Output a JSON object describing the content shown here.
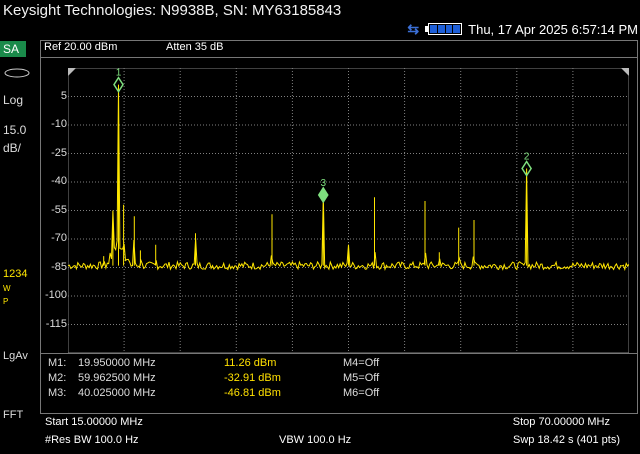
{
  "title": "Keysight Technologies: N9938B, SN: MY63185843",
  "status": {
    "datetime": "Thu, 17 Apr 2025 6:57:14 PM",
    "usb_icon": "usb-icon",
    "battery_icon": "battery-icon",
    "battery_cells": 4
  },
  "left": {
    "mode": "SA",
    "scale_type": "Log",
    "scale_value": "15.0",
    "scale_unit": "dB/",
    "trace_numbers": "1234",
    "trace_w": "W",
    "trace_p": "P",
    "detector": "LgAv",
    "sweep_type": "FFT"
  },
  "header": {
    "ref": "Ref 20.00 dBm",
    "atten": "Atten 35 dB"
  },
  "markers_table": [
    {
      "label": "M1:",
      "freq": "19.950000 MHz",
      "amp": "11.26 dBm",
      "other": "M4=Off"
    },
    {
      "label": "M2:",
      "freq": "59.962500 MHz",
      "amp": "-32.91 dBm",
      "other": "M5=Off"
    },
    {
      "label": "M3:",
      "freq": "40.025000 MHz",
      "amp": "-46.81 dBm",
      "other": "M6=Off"
    }
  ],
  "bottom": {
    "start": "Start 15.00000 MHz",
    "stop": "Stop 70.00000 MHz",
    "rbw": "#Res BW 100.0  Hz",
    "vbw": "VBW 100.0  Hz",
    "sweep": "Swp 18.42  s (401 pts)"
  },
  "colors": {
    "trace": "#ffe600",
    "marker": "#7fe07f",
    "grid": "#808080",
    "mode_bg": "#1a8a4a"
  },
  "chart_data": {
    "type": "line",
    "xlabel": "",
    "ylabel": "",
    "xlim": [
      15,
      70
    ],
    "ylim": [
      -130,
      20
    ],
    "y_ticks": [
      5,
      -10,
      -25,
      -40,
      -55,
      -70,
      -85,
      -100,
      -115
    ],
    "noise_floor": -84,
    "peaks": [
      {
        "f": 19.95,
        "a": 11.26
      },
      {
        "f": 20.45,
        "a": -52
      },
      {
        "f": 19.4,
        "a": -55
      },
      {
        "f": 21.5,
        "a": -58
      },
      {
        "f": 22.1,
        "a": -76
      },
      {
        "f": 18.5,
        "a": -79
      },
      {
        "f": 23.6,
        "a": -73
      },
      {
        "f": 27.5,
        "a": -67
      },
      {
        "f": 35.0,
        "a": -57
      },
      {
        "f": 40.025,
        "a": -46.81
      },
      {
        "f": 42.5,
        "a": -73
      },
      {
        "f": 45.05,
        "a": -48
      },
      {
        "f": 50.0,
        "a": -50
      },
      {
        "f": 51.4,
        "a": -77
      },
      {
        "f": 53.3,
        "a": -64
      },
      {
        "f": 54.8,
        "a": -60
      },
      {
        "f": 59.9625,
        "a": -32.91
      }
    ],
    "markers": [
      {
        "id": "1",
        "f": 19.95,
        "a": 11.26,
        "shape": "diamond"
      },
      {
        "id": "2",
        "f": 59.9625,
        "a": -32.91,
        "shape": "diamond"
      },
      {
        "id": "3",
        "f": 40.025,
        "a": -46.81,
        "shape": "filled"
      }
    ]
  }
}
